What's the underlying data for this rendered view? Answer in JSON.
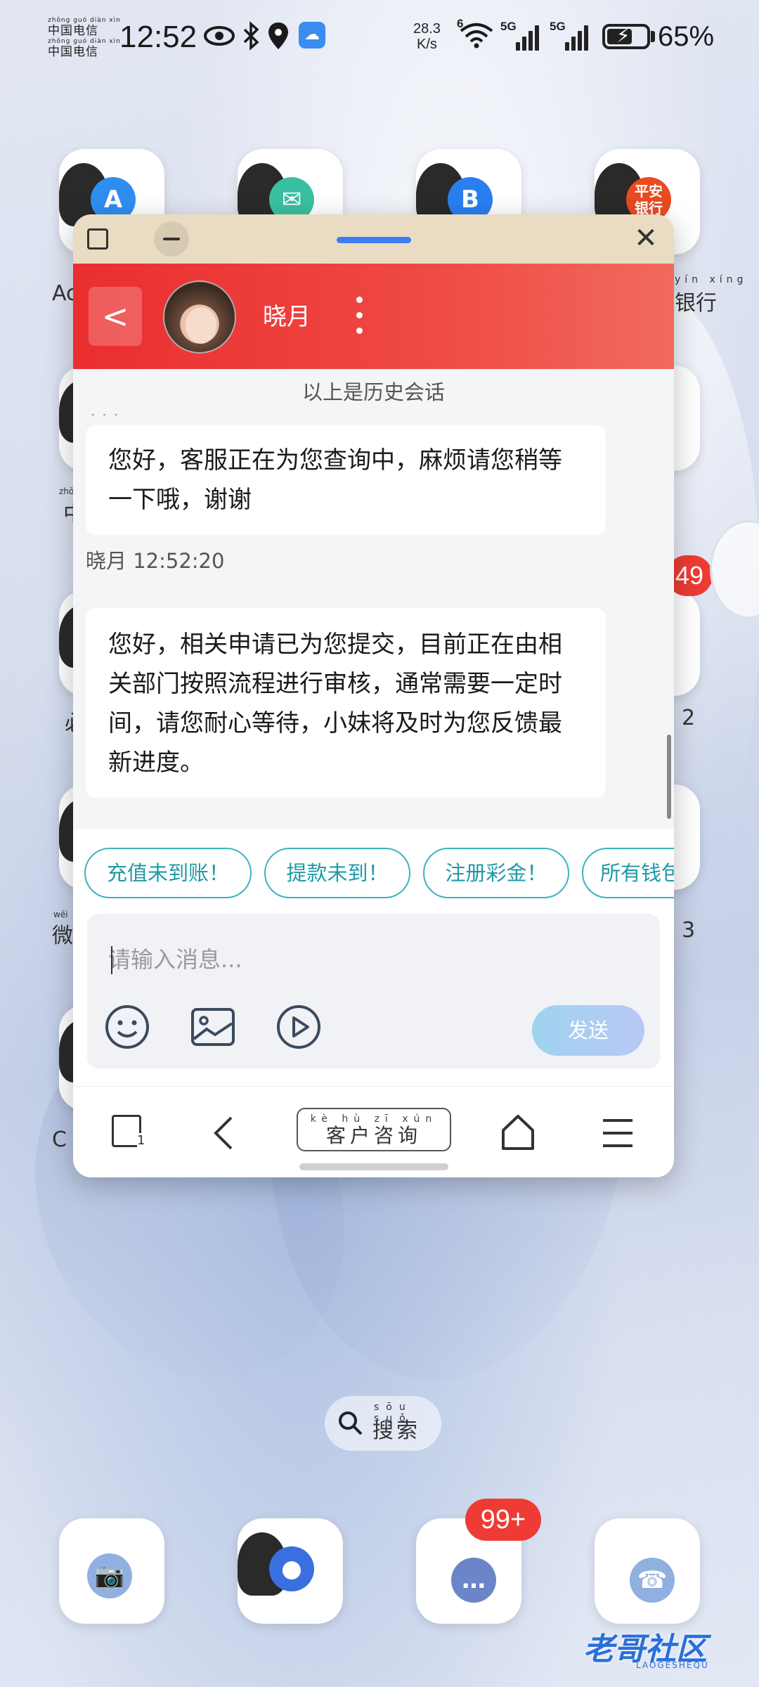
{
  "status_bar": {
    "carrier_pinyin_1": "zhōng guó diàn xìn",
    "carrier_1": "中国电信",
    "carrier_pinyin_2": "zhōng guó diàn xìn",
    "carrier_2": "中国电信",
    "time": "12:52",
    "net_speed_value": "28.3",
    "net_speed_unit": "K/s",
    "wifi_label": "6",
    "signal_1_label": "5G",
    "signal_2_label": "5G",
    "battery_level": 0.65,
    "battery_percent": "65%"
  },
  "home_screen": {
    "label_top_left": "Ac",
    "label_bank_pinyin": "yín xíng",
    "label_bank": "银行",
    "label_mid_left_pinyin": "zhōng",
    "label_mid_left": "中",
    "label_left_2": "必",
    "label_right_2": "2",
    "label_wechat_pinyin": "wēi",
    "label_wechat": "微",
    "label_right_3": "3",
    "label_bottom_left": "C",
    "badge_right": "49",
    "badge_dock": "99+",
    "bank_logo": "平安\n银行",
    "search_pinyin": "sōu suǒ",
    "search_label": "搜索",
    "watermark": "老哥社区",
    "watermark_sub": "LAOGESHEQU"
  },
  "chat_window": {
    "agent_name": "晓月",
    "history_note": "以上是历史会话",
    "messages": [
      {
        "text": "您好，客服正在为您查询中，麻烦请您稍等一下哦，谢谢"
      },
      {
        "sender_time": "晓月 12:52:20",
        "text": "您好，相关申请已为您提交，目前正在由相关部门按照流程进行审核，通常需要一定时间，请您耐心等待，小妹将及时为您反馈最新进度。"
      }
    ],
    "quick_replies": [
      "充值未到账！",
      "提款未到！",
      "注册彩金！",
      "所有钱包"
    ],
    "input_placeholder": "请输入消息...",
    "send_label": "发送",
    "nav": {
      "tab_count": "1",
      "consult_pinyin": "kè hù zī xún",
      "consult_label": "客户咨询"
    }
  },
  "colors": {
    "header_red": "#ea2e2e",
    "quick_reply_teal": "#1f9aa6",
    "window_bar": "#e9dcc3"
  },
  "icons": [
    "eye-icon",
    "bluetooth-icon",
    "location-icon",
    "cloud-icon",
    "wifi-icon",
    "signal-icon",
    "battery-icon",
    "back-icon",
    "more-icon",
    "emoji-icon",
    "image-icon",
    "video-icon",
    "tabs-icon",
    "home-icon",
    "menu-icon",
    "search-icon",
    "close-icon"
  ]
}
